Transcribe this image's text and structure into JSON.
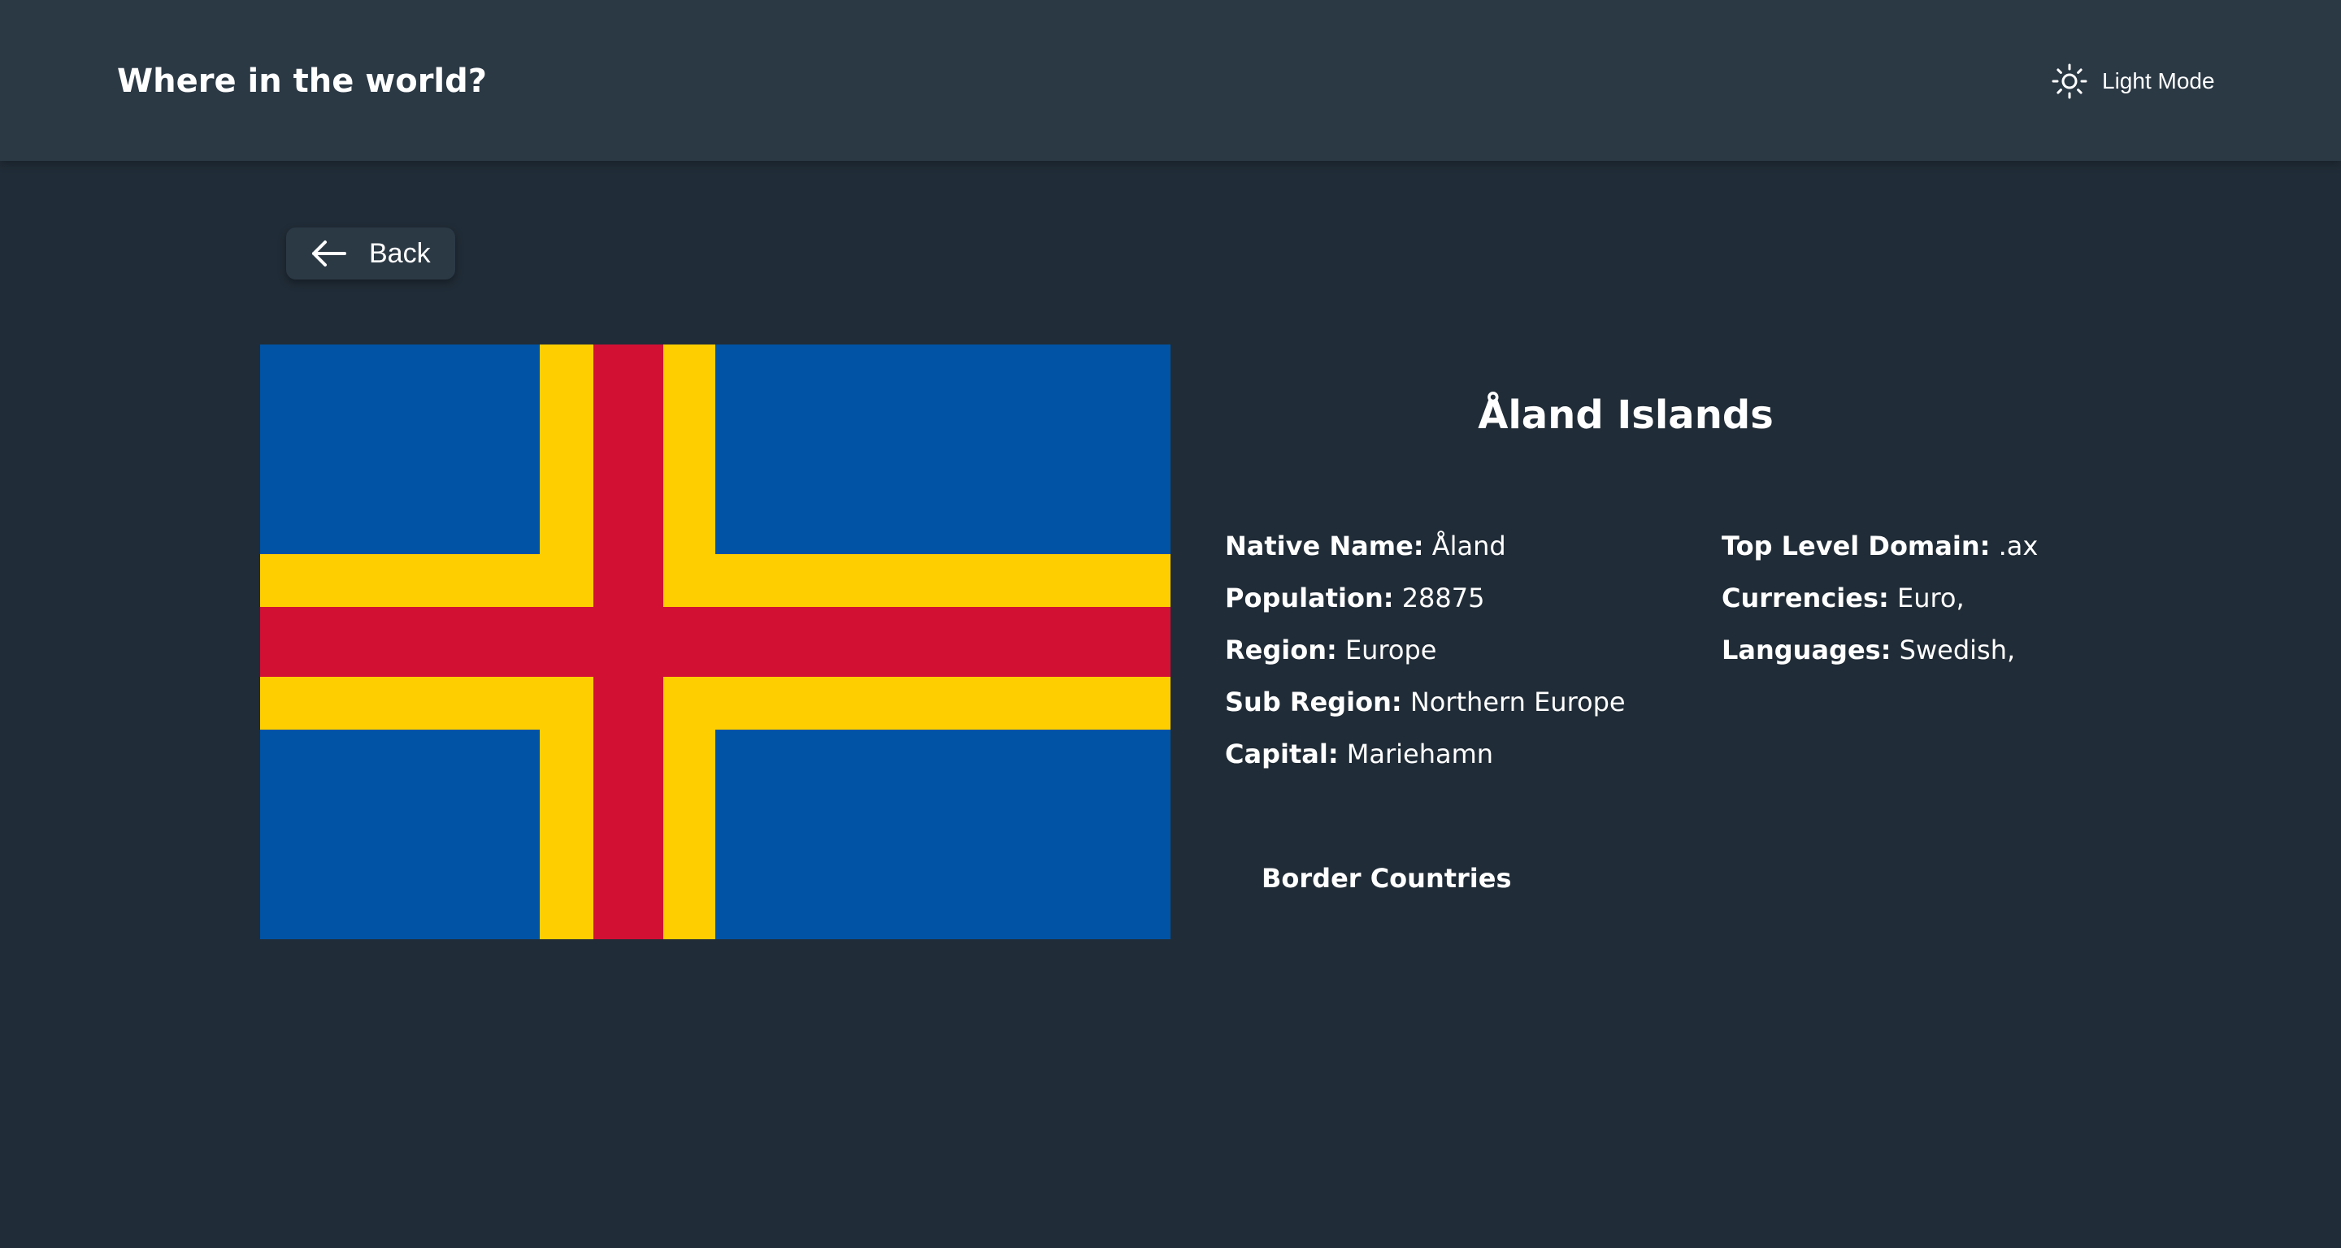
{
  "header": {
    "title": "Where in the world?",
    "theme_toggle": {
      "label": "Light Mode",
      "icon": "sun-icon"
    }
  },
  "back_button": {
    "label": "Back",
    "icon": "arrow-left-icon"
  },
  "country": {
    "name": "Åland Islands",
    "flag_colors": {
      "blue": "#0053a5",
      "yellow": "#ffce00",
      "red": "#d21034"
    },
    "details_left": [
      {
        "key": "Native Name:",
        "value": "Åland"
      },
      {
        "key": "Population:",
        "value": "28875"
      },
      {
        "key": "Region:",
        "value": "Europe"
      },
      {
        "key": "Sub Region:",
        "value": "Northern Europe"
      },
      {
        "key": "Capital:",
        "value": "Mariehamn"
      }
    ],
    "details_right": [
      {
        "key": "Top Level Domain:",
        "value": ".ax"
      },
      {
        "key": "Currencies:",
        "value": "Euro,"
      },
      {
        "key": "Languages:",
        "value": "Swedish,"
      }
    ],
    "border_countries_heading": "Border Countries"
  },
  "colors": {
    "background": "#202c37",
    "elements": "#2b3945",
    "text": "#ffffff"
  }
}
